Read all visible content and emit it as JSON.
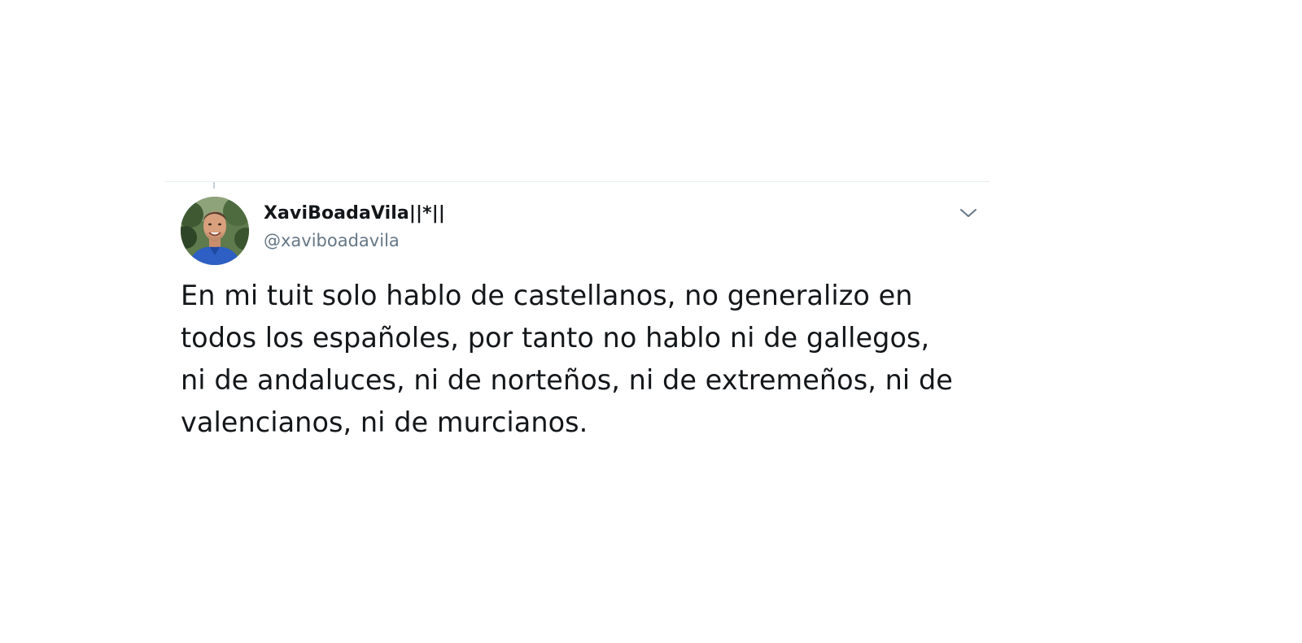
{
  "tweet": {
    "display_name": "XaviBoadaVila||*||",
    "handle": "@xaviboadavila",
    "text": "En mi tuit solo hablo de castellanos, no generalizo en\ntodos los españoles, por tanto no hablo ni de gallegos,\nni de andaluces, ni de norteños, ni de extremeños, ni de\nvalencianos, ni de murcianos.",
    "icons": {
      "avatar": "profile-photo",
      "menu": "chevron-down-icon"
    }
  },
  "colors": {
    "text_primary": "#14171a",
    "text_secondary": "#657786",
    "divider": "#e6ecf0",
    "icon": "#657786"
  }
}
